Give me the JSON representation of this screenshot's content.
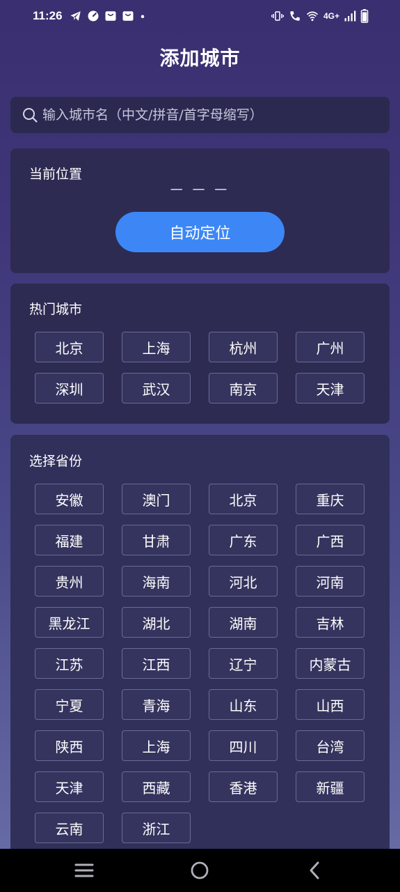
{
  "status_bar": {
    "time": "11:26",
    "network": "4G+"
  },
  "title": "添加城市",
  "search": {
    "placeholder": "输入城市名（中文/拼音/首字母缩写）",
    "value": ""
  },
  "location": {
    "title": "当前位置",
    "value": "— — —",
    "button_label": "自动定位"
  },
  "hot_cities": {
    "title": "热门城市",
    "items": [
      "北京",
      "上海",
      "杭州",
      "广州",
      "深圳",
      "武汉",
      "南京",
      "天津"
    ]
  },
  "provinces": {
    "title": "选择省份",
    "items": [
      "安徽",
      "澳门",
      "北京",
      "重庆",
      "福建",
      "甘肃",
      "广东",
      "广西",
      "贵州",
      "海南",
      "河北",
      "河南",
      "黑龙江",
      "湖北",
      "湖南",
      "吉林",
      "江苏",
      "江西",
      "辽宁",
      "内蒙古",
      "宁夏",
      "青海",
      "山东",
      "山西",
      "陕西",
      "上海",
      "四川",
      "台湾",
      "天津",
      "西藏",
      "香港",
      "新疆",
      "云南",
      "浙江"
    ]
  },
  "colors": {
    "accent": "#3c87f5",
    "card": "#2d2b52",
    "chip_border": "#6a6a96"
  }
}
